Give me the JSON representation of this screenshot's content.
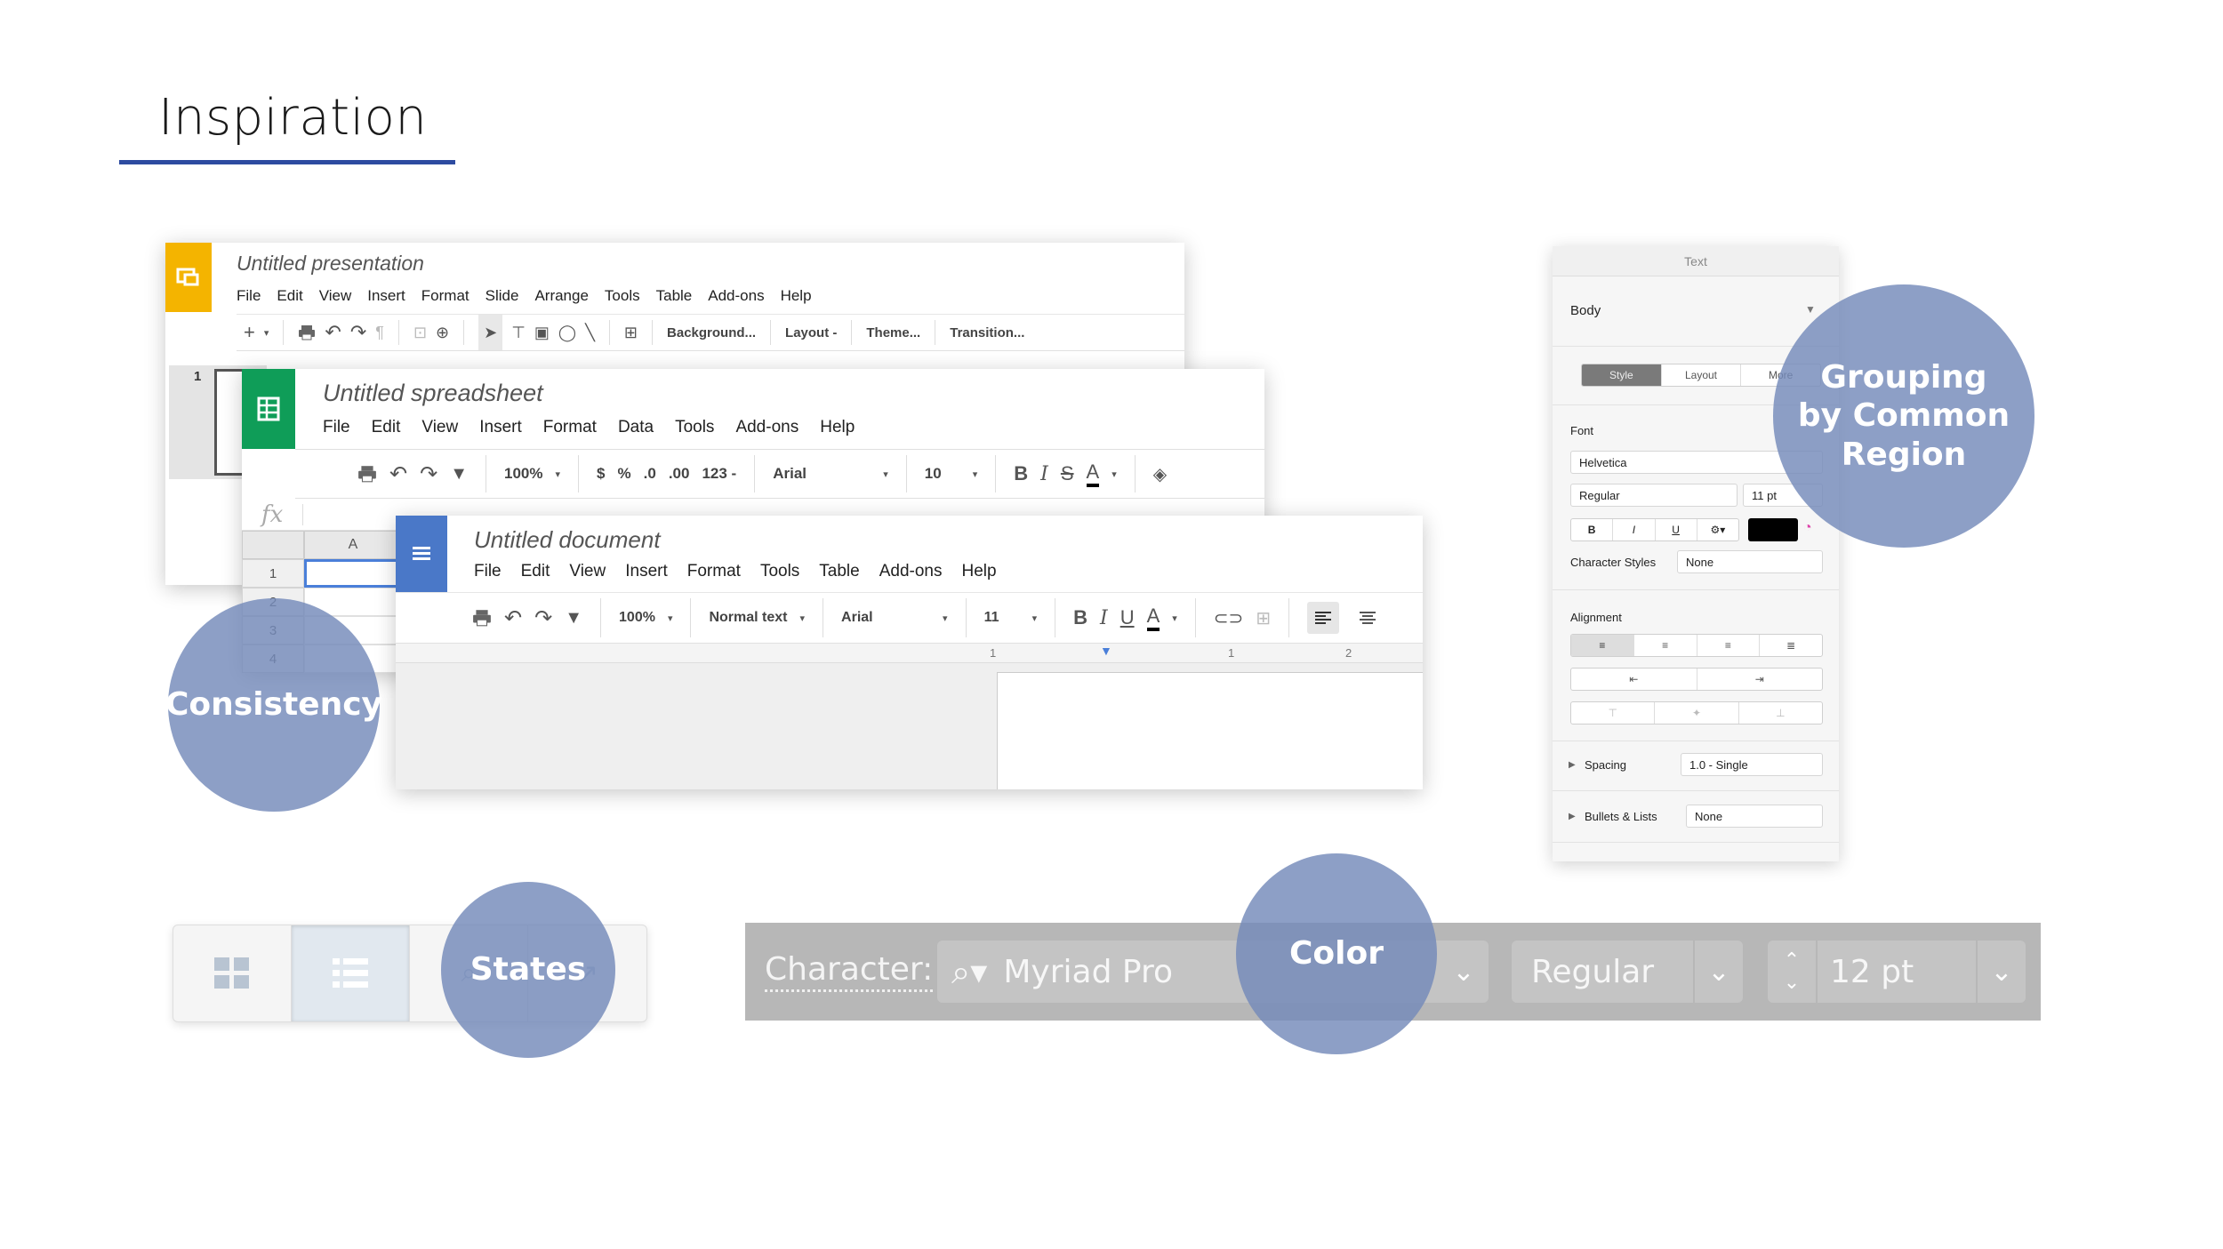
{
  "slide": {
    "title": "Inspiration",
    "accent_color": "#2d4ba0"
  },
  "presentation": {
    "doc_title": "Untitled presentation",
    "icon": "slides-icon",
    "icon_color": "#f4b400",
    "menu": [
      "File",
      "Edit",
      "View",
      "Insert",
      "Format",
      "Slide",
      "Arrange",
      "Tools",
      "Table",
      "Add-ons",
      "Help"
    ],
    "toolbar": {
      "background": "Background...",
      "layout": "Layout -",
      "theme": "Theme...",
      "transition": "Transition..."
    },
    "slide_number": "1"
  },
  "spreadsheet": {
    "doc_title": "Untitled spreadsheet",
    "icon": "sheets-icon",
    "icon_color": "#0f9d58",
    "menu": [
      "File",
      "Edit",
      "View",
      "Insert",
      "Format",
      "Data",
      "Tools",
      "Add-ons",
      "Help"
    ],
    "toolbar": {
      "zoom": "100%",
      "currency": "$",
      "percent": "%",
      "dec_less": ".0",
      "dec_more": ".00",
      "number_format": "123 -",
      "font": "Arial",
      "font_size": "10"
    },
    "fx": "fx",
    "column_header": "A",
    "rows": [
      "1",
      "2",
      "3",
      "4"
    ]
  },
  "document": {
    "doc_title": "Untitled document",
    "icon": "docs-icon",
    "icon_color": "#4a78c8",
    "menu": [
      "File",
      "Edit",
      "View",
      "Insert",
      "Format",
      "Tools",
      "Table",
      "Add-ons",
      "Help"
    ],
    "toolbar": {
      "zoom": "100%",
      "style": "Normal text",
      "font": "Arial",
      "font_size": "11"
    },
    "ruler": [
      "1",
      "1",
      "1",
      "2"
    ]
  },
  "text_panel": {
    "header": "Text",
    "paragraph_style": "Body",
    "tabs": [
      "Style",
      "Layout",
      "More"
    ],
    "font_label": "Font",
    "font_family": "Helvetica",
    "font_weight": "Regular",
    "font_size": "11 pt",
    "bold": "B",
    "italic": "I",
    "underline": "U",
    "char_styles_label": "Character Styles",
    "char_styles_value": "None",
    "alignment_label": "Alignment",
    "spacing_label": "Spacing",
    "spacing_value": "1.0 - Single",
    "bullets_label": "Bullets & Lists",
    "bullets_value": "None"
  },
  "character_bar": {
    "label": "Character:",
    "font": "Myriad Pro",
    "weight": "Regular",
    "size": "12 pt"
  },
  "overlays": {
    "consistency": "Consistency",
    "grouping_line1": "Grouping",
    "grouping_line2": "by Common",
    "grouping_line3": "Region",
    "states": "States",
    "color": "Color",
    "circle_color": "#748aba"
  }
}
